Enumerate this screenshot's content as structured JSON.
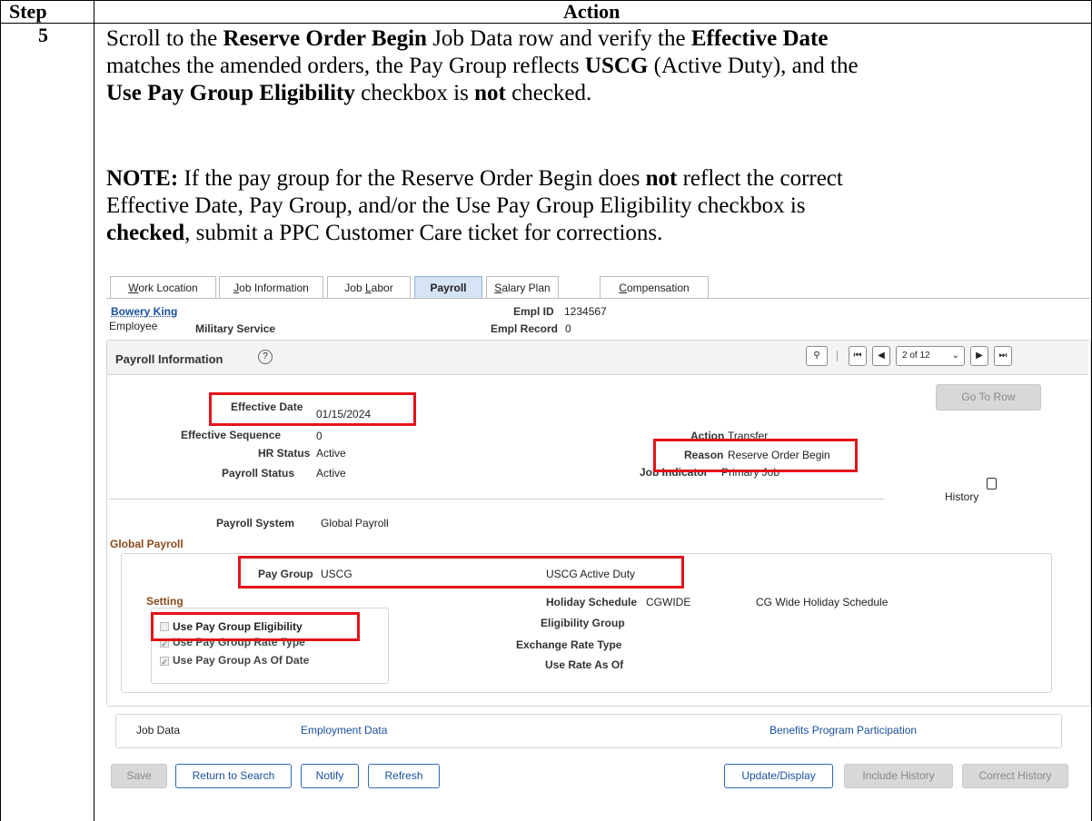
{
  "table": {
    "col_step": "Step",
    "col_action": "Action",
    "step_number": "5"
  },
  "instruction": {
    "p1_a": "Scroll to the ",
    "p1_b": "Reserve Order Begin",
    "p1_c": " Job Data row and verify the ",
    "p1_d": "Effective Date",
    "p1_e": "matches the amended orders, the Pay Group reflects ",
    "p1_f": "USCG",
    "p1_g": " (Active Duty), and the",
    "p1_h": "Use Pay Group Eligibility",
    "p1_i": " checkbox is ",
    "p1_j": "not",
    "p1_k": " checked.",
    "note_label": "NOTE:",
    "note_a": " If the pay group for the Reserve Order Begin does ",
    "note_b": "not",
    "note_c": " reflect the correct",
    "note_d": "Effective Date, Pay Group, and/or the Use Pay Group Eligibility checkbox is",
    "note_e": "checked",
    "note_f": ", submit a PPC Customer Care ticket for corrections."
  },
  "tabs": [
    {
      "label": "Work Location",
      "u": "W",
      "rest": "ork Location"
    },
    {
      "label": "Job Information",
      "u": "J",
      "rest": "ob Information"
    },
    {
      "label": "Job Labor",
      "pre": "Job ",
      "u": "L",
      "rest": "abor"
    },
    {
      "label": "Payroll",
      "active": true
    },
    {
      "label": "Salary Plan",
      "u": "S",
      "rest": "alary Plan"
    },
    {
      "label": "Compensation",
      "u": "C",
      "rest": "ompensation"
    }
  ],
  "employee": {
    "name": "Bowery King",
    "type": "Employee",
    "service": "Military Service",
    "empl_id_label": "Empl ID",
    "empl_id": "1234567",
    "empl_record_label": "Empl Record",
    "empl_record": "0"
  },
  "payroll_info": {
    "title": "Payroll Information",
    "pager": "2 of 12",
    "go_to_row": "Go To Row",
    "effective_date_label": "Effective Date",
    "effective_date": "01/15/2024",
    "effective_seq_label": "Effective Sequence",
    "effective_seq": "0",
    "hr_status_label": "HR Status",
    "hr_status": "Active",
    "payroll_status_label": "Payroll Status",
    "payroll_status": "Active",
    "action_label": "Action",
    "action": "Transfer",
    "reason_label": "Reason",
    "reason": "Reserve Order Begin",
    "job_indicator_label": "Job Indicator",
    "job_indicator": "Primary Job",
    "history": "History",
    "payroll_system_label": "Payroll System",
    "payroll_system": "Global Payroll"
  },
  "global_payroll": {
    "title": "Global Payroll",
    "pay_group_label": "Pay Group",
    "pay_group": "USCG",
    "pay_group_desc": "USCG Active Duty",
    "setting_title": "Setting",
    "cb1": "Use Pay Group Eligibility",
    "cb1_checked": false,
    "cb2": "Use Pay Group Rate Type",
    "cb2_checked": true,
    "cb3": "Use Pay Group As Of Date",
    "cb3_checked": true,
    "holiday_label": "Holiday Schedule",
    "holiday": "CGWIDE",
    "holiday_desc": "CG Wide Holiday Schedule",
    "elig_group_label": "Eligibility Group",
    "exch_rate_label": "Exchange Rate Type",
    "use_rate_label": "Use Rate As Of"
  },
  "links": {
    "job_data": "Job Data",
    "employment_data": "Employment Data",
    "benefits": "Benefits Program Participation"
  },
  "buttons": {
    "save": "Save",
    "return_to_search": "Return to Search",
    "notify": "Notify",
    "refresh": "Refresh",
    "update_display": "Update/Display",
    "include_history": "Include History",
    "correct_history": "Correct History"
  },
  "colors": {
    "highlight": "#e3131b",
    "active_tab": "#d6e4f5",
    "link": "#1a4f9c",
    "section_title": "#8a4a1a"
  }
}
